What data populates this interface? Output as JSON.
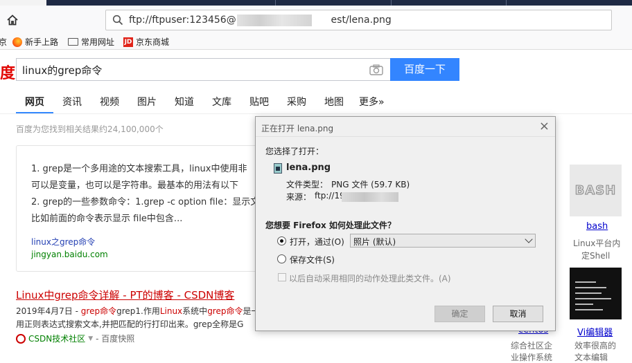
{
  "browser": {
    "url": "ftp://ftpuser:123456@19 est/lena.png",
    "url_prefix": "ftp://ftpuser:123456@19",
    "url_suffix": "est/lena.png",
    "bookmarks": [
      {
        "label": "京",
        "icon": "truncated"
      },
      {
        "label": "新手上路",
        "icon": "firefox-icon"
      },
      {
        "label": "常用网址",
        "icon": "folder-icon"
      },
      {
        "label": "京东商城",
        "icon": "jd-icon"
      }
    ],
    "jd_badge": "JD"
  },
  "baidu": {
    "logo_fragment": "度",
    "query": "linux的grep命令",
    "search_button": "百度一下",
    "tabs": [
      "网页",
      "资讯",
      "视频",
      "图片",
      "知道",
      "文库",
      "贴吧",
      "采购",
      "地图",
      "更多»"
    ],
    "result_count": "百度为您找到相关结果约24,100,000个",
    "card": {
      "line1": "1. grep是一个多用途的文本搜索工具，linux中使用非",
      "line2": "可以是变量，也可以是字符串。最基本的用法有以下",
      "line3": "2. grep的一些参数命令：1.grep -c option file：显示文",
      "line4": "比如前面的命令表示显示 file中包含...",
      "link": "linux之grep命令",
      "source": "jingyan.baidu.com"
    },
    "result": {
      "title": "Linux中grep命令详解 - PT的博客 - CSDN博客",
      "line1_date": "2019年4月7日 - ",
      "line1_a": "grep命令",
      "line1_b": "grep1.作用",
      "line1_c": "Linux",
      "line1_d": "系统中",
      "line1_e": "grep命令",
      "line1_f": "是一",
      "line2": "用正则表达式搜索文本,并把匹配的行打印出来。grep全称是G",
      "source": "CSDN技术社区",
      "snapshot": "- 百度快照"
    },
    "sidebar": {
      "bash_label": "BASH",
      "bash_link": "bash",
      "bash_desc1": "Linux平台内",
      "bash_desc2": "定Shell",
      "vi_link": "Vi编辑器",
      "vi_desc1": "效率很高的",
      "vi_desc2": "文本编辑",
      "centos_link": "centos",
      "centos_desc1": "综合社区企",
      "centos_desc2": "业操作系统"
    }
  },
  "dialog": {
    "title": "正在打开 lena.png",
    "close": "×",
    "chosen": "您选择了打开：",
    "filename": "lena.png",
    "type_label": "文件类型：",
    "type_value": "PNG 文件 (59.7 KB)",
    "source_label": "来源：",
    "source_value": "ftp://192",
    "question": "您想要 Firefox 如何处理此文件？",
    "open_with_label": "打开，通过(O)",
    "open_with_app": "照片 (默认)",
    "save_label": "保存文件(S)",
    "auto_label": "以后自动采用相同的动作处理此类文件。(A)",
    "ok": "确定",
    "cancel": "取消"
  }
}
